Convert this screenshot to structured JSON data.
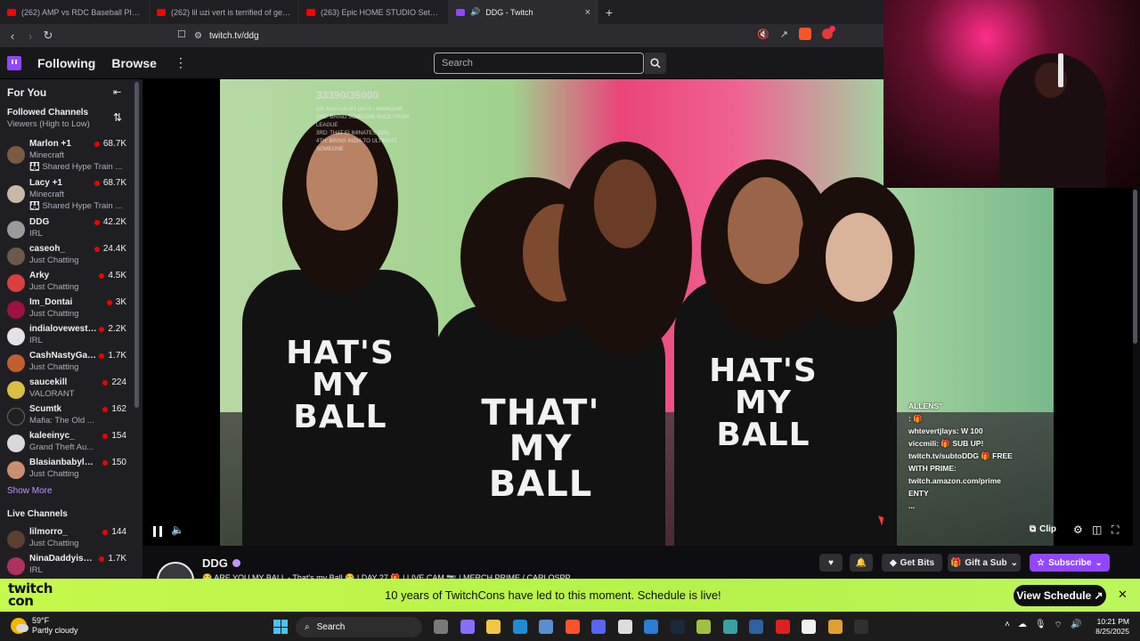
{
  "browser": {
    "tabs": [
      {
        "label": "(262) AMP vs RDC Baseball PISSED M",
        "favicon_color": "#ff0000",
        "active": false
      },
      {
        "label": "(262) lil uzi vert is terrified of getting",
        "favicon_color": "#ff0000",
        "active": false
      },
      {
        "label": "(263) Epic HOME STUDIO Setup 2025",
        "favicon_color": "#ff0000",
        "active": false
      },
      {
        "label": "DDG - Twitch",
        "favicon_color": "#9147ff",
        "active": true
      }
    ],
    "new_tab": "+",
    "url": "twitch.tv/ddg",
    "ext_badge": "1"
  },
  "topnav": {
    "following": "Following",
    "browse": "Browse",
    "more": "⋮",
    "search_placeholder": "Search"
  },
  "sidebar": {
    "for_you": "For You",
    "followed_title": "Followed Channels",
    "followed_sort": "Viewers (High to Low)",
    "channels": [
      {
        "name": "Marlon +1",
        "game": "Minecraft",
        "hype": "👪 Shared Hype Train ...",
        "viewers": "68.7K",
        "avatar": "#7a5a40"
      },
      {
        "name": "Lacy +1",
        "game": "Minecraft",
        "hype": "👪 Shared Hype Train ...",
        "viewers": "68.7K",
        "avatar": "#c8b8a8"
      },
      {
        "name": "DDG",
        "game": "IRL",
        "viewers": "42.2K",
        "avatar": "#9a9a9a"
      },
      {
        "name": "caseoh_",
        "game": "Just Chatting",
        "viewers": "24.4K",
        "avatar": "#6b5a4a"
      },
      {
        "name": "Arky",
        "game": "Just Chatting",
        "viewers": "4.5K",
        "avatar": "#d84040"
      },
      {
        "name": "Im_Dontai",
        "game": "Just Chatting",
        "viewers": "3K",
        "avatar": "#a01040"
      },
      {
        "name": "indialovewestb...",
        "game": "IRL",
        "viewers": "2.2K",
        "avatar": "#e8e0e8"
      },
      {
        "name": "CashNastyGam...",
        "game": "Just Chatting",
        "viewers": "1.7K",
        "avatar": "#c06030"
      },
      {
        "name": "saucekill",
        "game": "VALORANT",
        "viewers": "224",
        "avatar": "#d8c040"
      },
      {
        "name": "Scumtk",
        "game": "Mafia: The Old ...",
        "viewers": "162",
        "avatar": "#202020"
      },
      {
        "name": "kaleeinyc_",
        "game": "Grand Theft Au...",
        "viewers": "154",
        "avatar": "#d8d8d8"
      },
      {
        "name": "Blasianbabyloiaa",
        "game": "Just Chatting",
        "viewers": "150",
        "avatar": "#c89070"
      }
    ],
    "show_more": "Show More",
    "live_title": "Live Channels",
    "live_channels": [
      {
        "name": "lilmorro_",
        "game": "Just Chatting",
        "viewers": "144",
        "avatar": "#5a4030"
      },
      {
        "name": "NinaDaddyisBa...",
        "game": "IRL",
        "viewers": "1.7K",
        "avatar": "#b03060"
      }
    ]
  },
  "video": {
    "goal": "33390/35000",
    "overlay_lines": [
      "1st: BUSTED BY DATE / BIGROOM",
      "2ND: BRING SOMEONE BACK FROM LEAGUE",
      "3RD: THAT ELIMINATES GIRL",
      "4TH: BRING INDIA TO ULTIMATE SOMEONE"
    ],
    "shirt_line1": "HAT'S",
    "shirt_line2": "MY",
    "shirt_line3": "BALL",
    "shirt2_line1": "THAT'",
    "shirt2_line2": "MY",
    "shirt2_line3": "BALL",
    "chat_overlay": [
      "ALLENS\"",
      "           : 🎁",
      "whtevertjlays: W 100",
      "viccmili: 🎁 SUB UP!",
      "twitch.tv/subtoDDG 🎁 FREE",
      "WITH PRIME:",
      "twitch.amazon.com/prime",
      "              ENTY",
      "              ..."
    ],
    "clip_label": "Clip"
  },
  "channel": {
    "name": "DDG",
    "title": "😂 ARE YOU MY BALL - That's my Ball 😂 | DAY 27 🎁 | LIVE CAM 📷 | MERCH PRIME / CARLOSPP",
    "get_bits": "Get Bits",
    "gift_sub": "Gift a Sub",
    "subscribe": "Subscribe"
  },
  "promo": {
    "logo_line1": "twitch",
    "logo_line2": "con",
    "text": "10 years of TwitchCons have led to this moment. Schedule is live!",
    "button": "View Schedule ↗",
    "close": "✕"
  },
  "taskbar": {
    "temp": "59°F",
    "weather": "Partly cloudy",
    "search": "Search",
    "time": "10:21 PM",
    "date": "8/25/2025",
    "apps": [
      {
        "name": "task-view-icon",
        "color": "#7a7a7a"
      },
      {
        "name": "copilot-icon",
        "color": "#8a6cff"
      },
      {
        "name": "file-explorer-icon",
        "color": "#f2c744"
      },
      {
        "name": "edge-icon",
        "color": "#1e8bd6"
      },
      {
        "name": "store-icon",
        "color": "#5a8ed0"
      },
      {
        "name": "brave-icon",
        "color": "#fb542b"
      },
      {
        "name": "discord-icon",
        "color": "#5865f2"
      },
      {
        "name": "chatgpt-icon",
        "color": "#dddddd"
      },
      {
        "name": "word-icon",
        "color": "#2b7cd3"
      },
      {
        "name": "steam-icon",
        "color": "#1b2838"
      },
      {
        "name": "game-icon",
        "color": "#a0c040"
      },
      {
        "name": "app-icon-globe",
        "color": "#3aa0a0"
      },
      {
        "name": "app-icon-blue",
        "color": "#3060a0"
      },
      {
        "name": "adobe-icon",
        "color": "#e02020"
      },
      {
        "name": "epic-icon",
        "color": "#f0f0f0"
      },
      {
        "name": "app-icon-orange",
        "color": "#e0a030"
      },
      {
        "name": "obs-icon",
        "color": "#303030"
      }
    ]
  }
}
